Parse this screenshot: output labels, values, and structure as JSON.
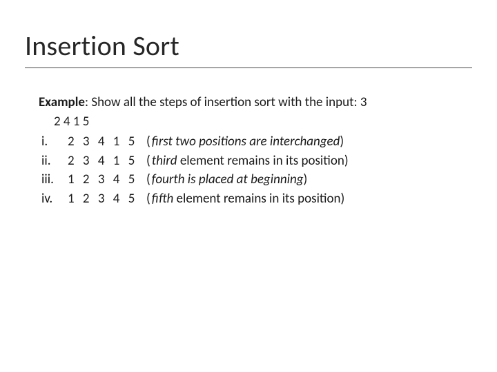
{
  "title": "Insertion Sort",
  "example_label": "Example",
  "prompt_tail": ": Show all the steps of  insertion sort with the input:  3",
  "input_line2": "2  4  1  5",
  "steps": [
    {
      "num": "i.",
      "seq": "2 3 4 1 5",
      "pre": "first two positions are interchanged"
    },
    {
      "num": "ii.",
      "seq": "2 3 4 1 5",
      "pre": "third",
      "mid": " element remains in its position"
    },
    {
      "num": "iii.",
      "seq": "1 2 3 4 5",
      "pre": "fourth is placed at beginning"
    },
    {
      "num": "iv.",
      "seq": "1 2 3 4 5",
      "pre": "fifth",
      "mid": "  element remains in its position",
      "pad": " "
    }
  ]
}
